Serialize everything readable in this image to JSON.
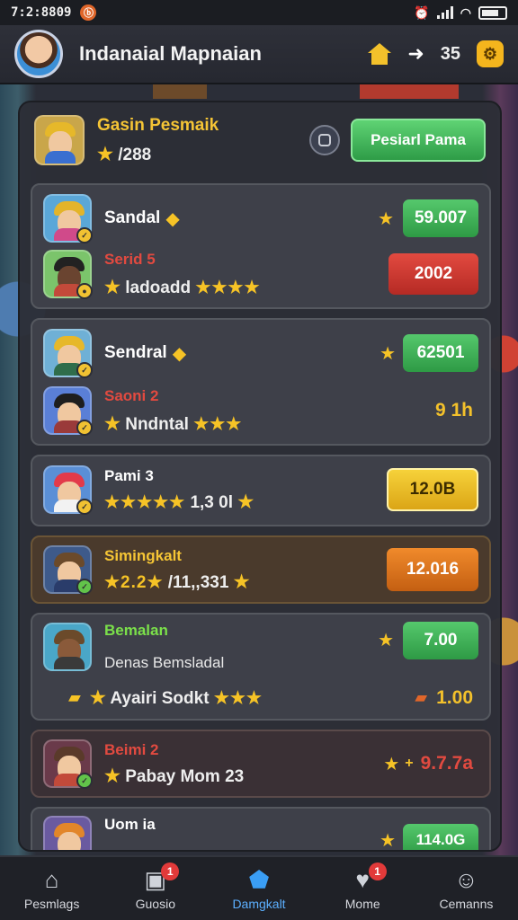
{
  "status": {
    "time": "7:2:8809",
    "notification_glyph": "ⓑ"
  },
  "header": {
    "title": "Indanaial Mapnaian",
    "count": "35"
  },
  "top_card": {
    "title": "Gasin Pesmaik",
    "score": "/288",
    "button": "Pesiarl Pama"
  },
  "cards": [
    {
      "rows": [
        {
          "name": "Sandal",
          "name_color": "#ffffff",
          "pill": "59.007",
          "pill_style": "green"
        },
        {
          "name": "Serid 5",
          "name_color": "#e24a40",
          "line2": "ladoadd",
          "stars": "★★★★",
          "pill": "2002",
          "pill_style": "red"
        }
      ]
    },
    {
      "rows": [
        {
          "name": "Sendral",
          "name_color": "#ffffff",
          "pill": "62501",
          "pill_style": "green"
        },
        {
          "name": "Saoni 2",
          "name_color": "#e24a40",
          "line2": "Nndntal",
          "stars": "★★★",
          "value": "9 1h"
        }
      ]
    },
    {
      "rows": [
        {
          "name": "Pami 3",
          "name_color": "#ffffff",
          "line2_prefix": "★★★★★",
          "line2": "1,3 0l",
          "pill": "12.0B",
          "pill_style": "yellow"
        }
      ]
    },
    {
      "rows": [
        {
          "name": "Simingkalt",
          "name_color": "#f5c535",
          "line2_prefix": "★2.2★",
          "line2": "/11,,331",
          "pill": "12.016",
          "pill_style": "orange"
        }
      ]
    },
    {
      "rows": [
        {
          "name": "Bemalan",
          "name_color": "#7be04a",
          "pill": "7.00",
          "pill_style": "green"
        },
        {
          "name": "Denas Bemsladal",
          "name_color": "#e8e8e8",
          "line2": "Ayairi Sodkt",
          "stars": "★★★",
          "value": "1.00"
        }
      ]
    },
    {
      "rows": [
        {
          "name": "Beimi 2",
          "name_color": "#e24a40",
          "line2": "Pabay Mom 23",
          "value": "9.7.7a"
        }
      ]
    },
    {
      "rows": [
        {
          "name": "Uom ia",
          "name_color": "#ffffff",
          "pill": "114.0G",
          "pill_style": "green"
        }
      ]
    }
  ],
  "tabs": [
    {
      "label": "Pesmlags",
      "icon": "home-icon"
    },
    {
      "label": "Guosio",
      "icon": "boost-icon",
      "badge": "1"
    },
    {
      "label": "Damgkalt",
      "icon": "shield-icon"
    },
    {
      "label": "Mome",
      "icon": "heart-icon",
      "badge": "1"
    },
    {
      "label": "Cemanns",
      "icon": "user-icon"
    }
  ],
  "colors": {
    "accent": "#3a9ef5",
    "gold": "#f6c326",
    "panel": "#2c2e37"
  }
}
